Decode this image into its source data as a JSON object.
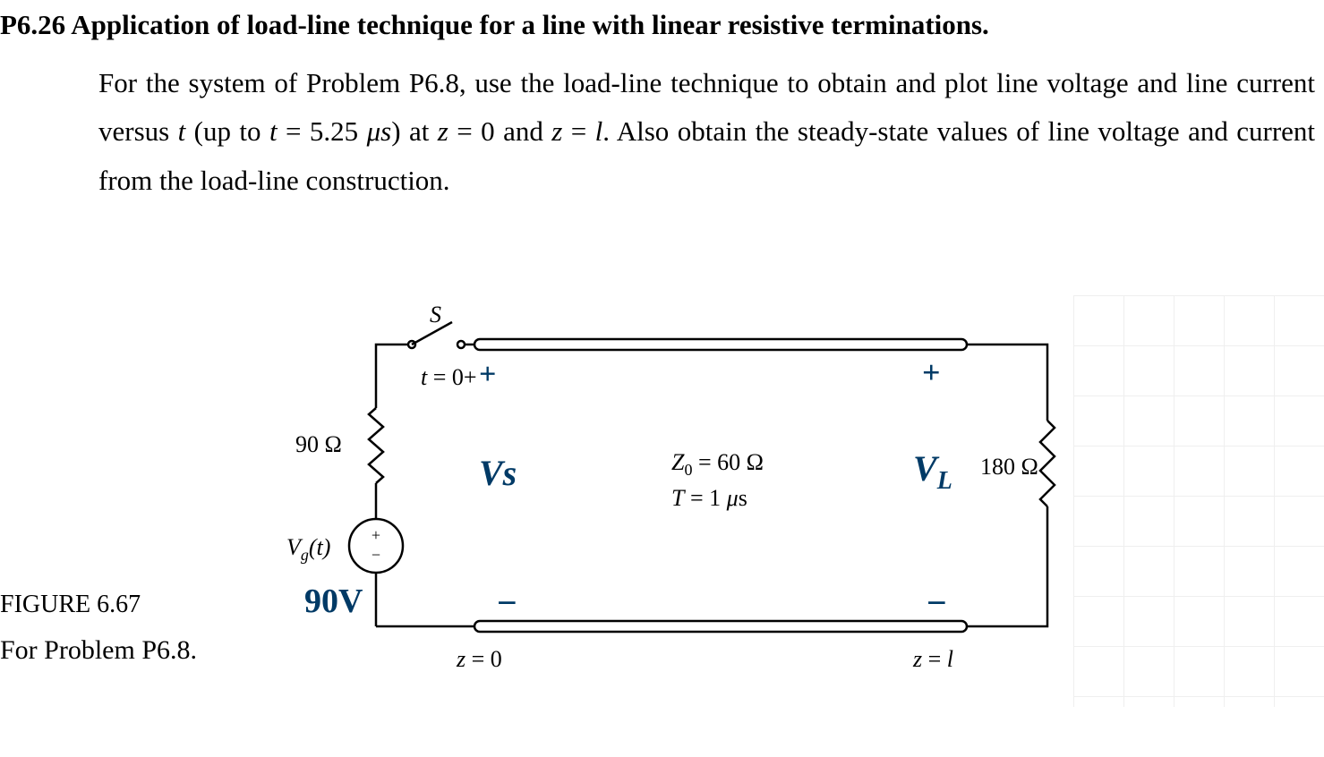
{
  "problem": {
    "number": "P6.26",
    "title": "Application of load-line technique for a line with linear resistive terminations.",
    "body_parts": [
      "For the system of Problem P6.8, use the load-line technique to obtain and plot line voltage and line current versus ",
      "t",
      " (up to ",
      "t",
      " = 5.25 ",
      "μs",
      ") at ",
      "z",
      " = 0 and ",
      "z",
      " = ",
      "l",
      ". Also obtain the steady-state values of line voltage and current from the load-line construction."
    ]
  },
  "figure": {
    "caption": "FIGURE 6.67",
    "subcaption": "For Problem P6.8."
  },
  "circuit": {
    "switch_label": "S",
    "switch_time": "t = 0+",
    "source_resistor": "90 Ω",
    "source_label": "V",
    "source_sub": "g",
    "source_arg": "(t)",
    "line_impedance": "Z₀ = 60 Ω",
    "line_delay": "T = 1 μs",
    "load_resistor": "180 Ω",
    "z_start": "z = 0",
    "z_end": "z = l"
  },
  "annotations": {
    "vs_label": "Vs",
    "vl_label": "V",
    "vl_sub": "L",
    "vg_value": "90V",
    "plus": "+",
    "minus_left": "−",
    "minus_right": "−"
  }
}
